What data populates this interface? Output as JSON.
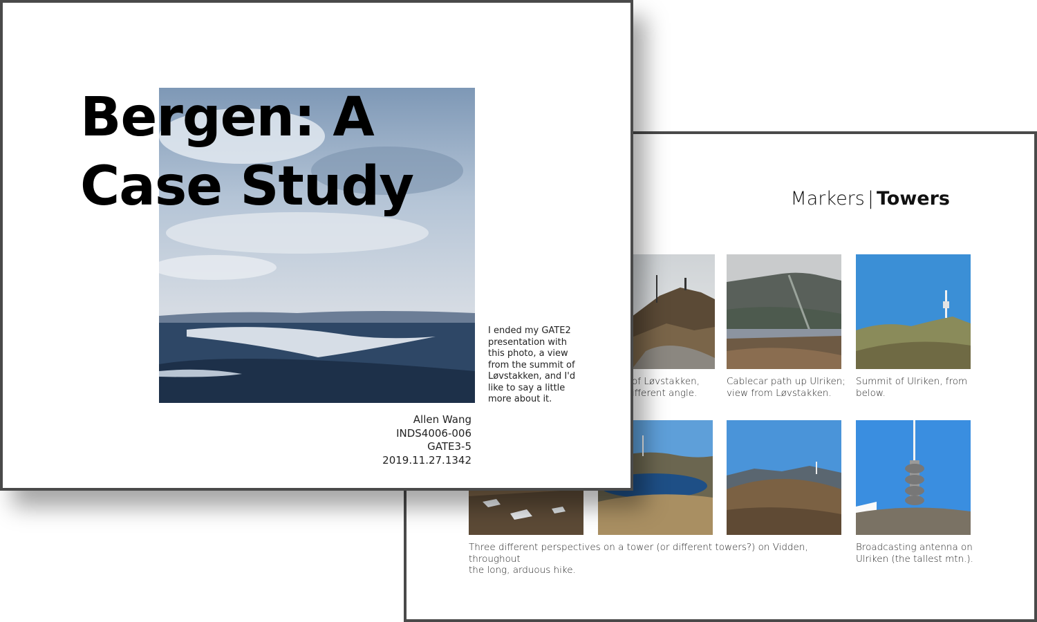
{
  "back_slide": {
    "title_part1": "Markers",
    "title_separator": "|",
    "title_part2": "Towers",
    "captions": {
      "row1_col2": "of Løvstakken,\nifferent angle.",
      "row1_col3": "Cablecar path up Ulriken;\nview from Løvstakken.",
      "row1_col4": "Summit of Ulriken, from\nbelow.",
      "row2_wide": "Three different perspectives on a tower (or different towers?) on Vidden, throughout\nthe long, arduous hike.",
      "row2_col4": "Broadcasting antenna on\nUlriken (the tallest mtn.)."
    }
  },
  "front_slide": {
    "title_line1": "Bergen: A",
    "title_line2": "Case Study",
    "note": "I ended my GATE2 presentation with this photo, a view from the summit of Løvstakken, and I'd like to say a little more about it.",
    "author": "Allen Wang",
    "course": "INDS4006-006",
    "section": "GATE3-5",
    "timestamp": "2019.11.27.1342"
  },
  "colors": {
    "border": "#4a4a4a",
    "sky_blue": "#3b8fd6",
    "text": "#111111"
  }
}
